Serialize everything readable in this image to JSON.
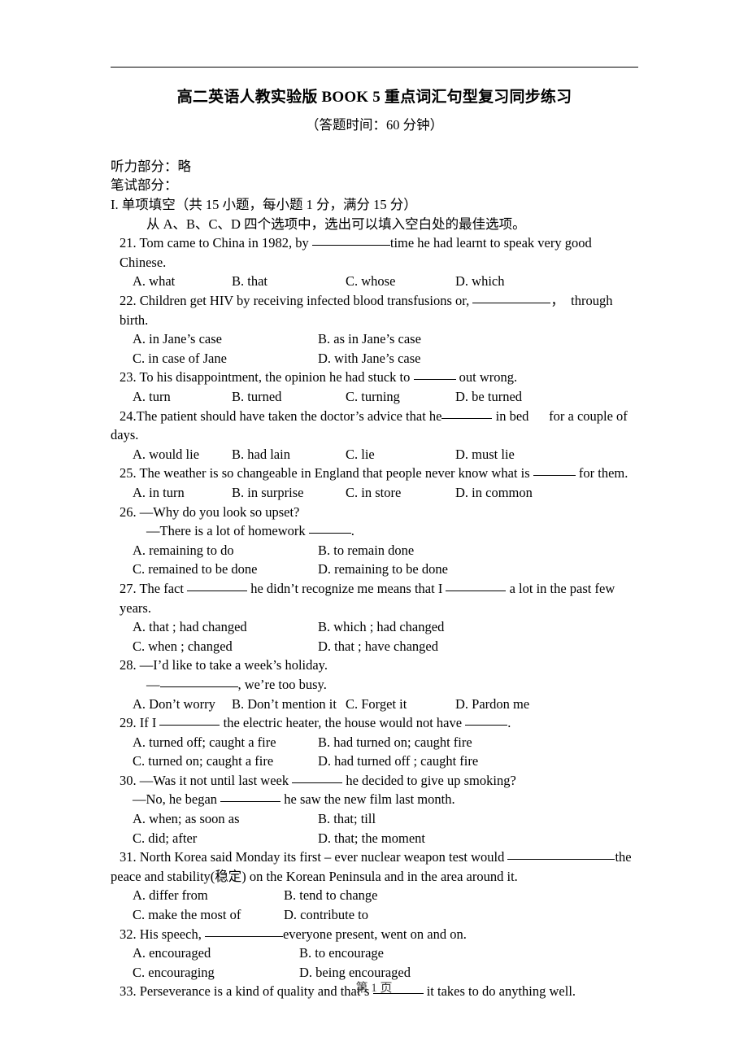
{
  "document": {
    "title": "高二英语人教实验版 BOOK 5  重点词汇句型复习同步练习",
    "subtitle": "（答题时间：60 分钟）",
    "footer": "第 1 页"
  },
  "preamble": {
    "listening": "听力部分：略",
    "written": "笔试部分：",
    "section_heading": "I. 单项填空（共 15 小题，每小题 1 分，满分 15 分）",
    "instruction": "从 A、B、C、D 四个选项中，选出可以填入空白处的最佳选项。"
  },
  "questions": [
    {
      "id": "21",
      "stem_before": "21. Tom came to China in 1982, by ",
      "stem_after": "time he had learnt to speak very good Chinese.",
      "blank": "b-xl",
      "layout": "four",
      "options": [
        "A. what",
        "B. that",
        "C. whose",
        "D. which"
      ]
    },
    {
      "id": "22",
      "stem_before": "22. Children get HIV by receiving infected blood transfusions or, ",
      "stem_after": "，  through birth.",
      "blank": "b-xl",
      "layout": "two",
      "options": [
        "A. in Jane’s case",
        "B. as in Jane’s case",
        "C. in case of Jane",
        "D. with Jane’s case"
      ]
    },
    {
      "id": "23",
      "stem_before": "23. To his disappointment, the opinion he had stuck to ",
      "stem_after": " out wrong.",
      "blank": "b-sm",
      "layout": "four",
      "options": [
        "A. turn",
        "B. turned",
        "C. turning",
        "D. be turned"
      ]
    },
    {
      "id": "24",
      "stem_before": "24.The patient should have taken the doctor’s advice that he",
      "stem_after": " in bed      for a couple of",
      "wrap_line": "days.",
      "blank": "b-md",
      "layout": "four",
      "options": [
        "A. would lie",
        "B. had lain",
        "C. lie",
        "D. must lie"
      ]
    },
    {
      "id": "25",
      "stem_before": "25. The weather is so changeable in England that people never know what is ",
      "stem_after": " for them.",
      "blank": "b-sm",
      "layout": "four",
      "options": [
        "A. in turn",
        "B. in surprise",
        "C. in store",
        "D. in common"
      ]
    },
    {
      "id": "26",
      "stem_before": "26. —Why do you look so upset?",
      "stem_after": "",
      "reply_before": "—There is a lot of homework ",
      "reply_after": ".",
      "blank": "b-sm",
      "layout": "two",
      "options": [
        "A. remaining to do",
        "B. to remain done",
        "C. remained to be done",
        "D. remaining to be done"
      ]
    },
    {
      "id": "27",
      "stem_before": "27. The fact ",
      "stem_mid": " he didn’t recognize me means that I ",
      "stem_after": " a lot in the past few years.",
      "blank": "b-lg",
      "layout": "two",
      "options": [
        "A. that ; had changed",
        "B. which ; had changed",
        "C. when ; changed",
        "D. that ; have changed"
      ]
    },
    {
      "id": "28",
      "stem_before": "28. —I’d like to take a week’s holiday.",
      "stem_after": "",
      "reply_before": "—",
      "reply_after": ", we’re too busy.",
      "blank": "b-xl",
      "layout": "four",
      "options": [
        "A. Don’t worry",
        "B. Don’t mention it",
        "C. Forget it",
        "D. Pardon me"
      ]
    },
    {
      "id": "29",
      "stem_before": "29. If I ",
      "stem_mid": " the electric heater, the house would not have ",
      "stem_after": ".",
      "blank": "b-lg",
      "layout": "two",
      "options": [
        "A. turned off; caught a fire",
        "B. had turned on; caught fire",
        "C. turned on; caught a fire",
        "D. had turned off ; caught fire"
      ]
    },
    {
      "id": "30",
      "stem_before": "30. —Was it not until last week ",
      "stem_after": " he decided to give up smoking?",
      "reply_before": "—No, he began ",
      "reply_after": " he saw the new film last month.",
      "blank": "b-md",
      "layout": "two",
      "options": [
        "A. when; as soon as",
        "B. that; till",
        "C. did; after",
        "D. that; the moment"
      ]
    },
    {
      "id": "31",
      "stem_before": "31. North Korea said Monday its first – ever nuclear weapon test would ",
      "stem_after": "the",
      "wrap_line": "peace and stability(稳定) on the Korean Peninsula and in the area around it.",
      "blank": "b-xxl",
      "layout": "two",
      "options": [
        "A. differ from",
        "B. tend to change",
        "C. make the most of",
        "D. contribute to"
      ]
    },
    {
      "id": "32",
      "stem_before": "32. His speech, ",
      "stem_after": "everyone present, went on and on.",
      "blank": "b-xl",
      "layout": "two",
      "options": [
        "A. encouraged",
        "B. to encourage",
        "C. encouraging",
        "D. being encouraged"
      ]
    },
    {
      "id": "33",
      "stem_before": "33. Perseverance is a kind of quality and that’s ",
      "stem_after": " it takes to do anything well.",
      "blank": "b-md",
      "layout": "none",
      "options": []
    }
  ]
}
